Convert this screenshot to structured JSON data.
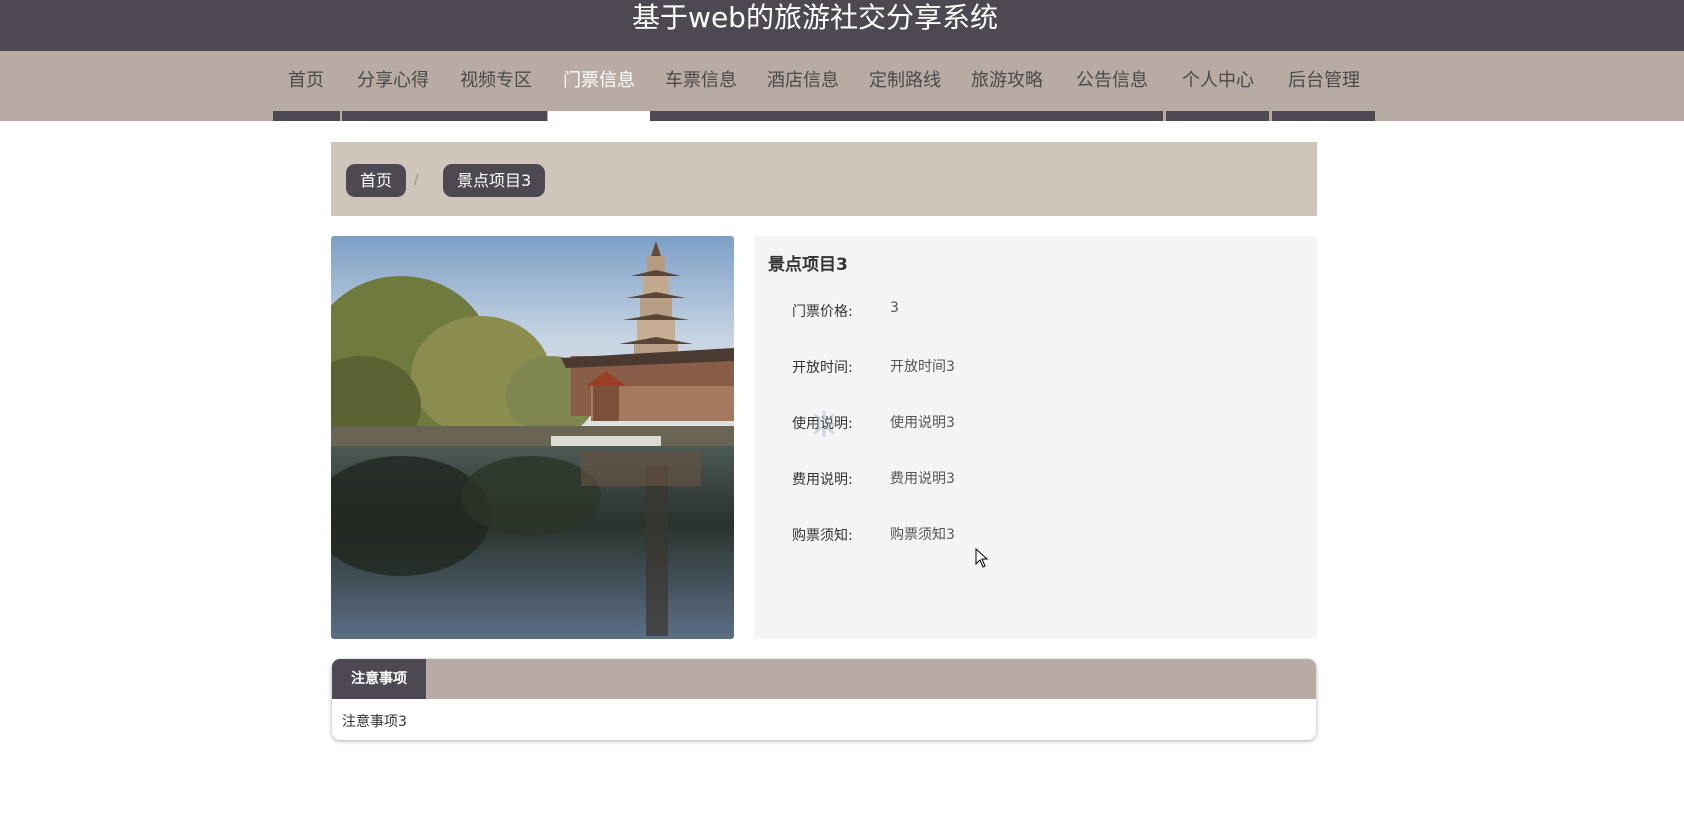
{
  "header": {
    "title": "基于web的旅游社交分享系统"
  },
  "nav": {
    "items": [
      {
        "label": "首页"
      },
      {
        "label": "分享心得"
      },
      {
        "label": "视频专区"
      },
      {
        "label": "门票信息"
      },
      {
        "label": "车票信息"
      },
      {
        "label": "酒店信息"
      },
      {
        "label": "定制路线"
      },
      {
        "label": "旅游攻略"
      },
      {
        "label": "公告信息"
      },
      {
        "label": "个人中心"
      },
      {
        "label": "后台管理"
      }
    ],
    "active": "门票信息"
  },
  "breadcrumb": {
    "home": "首页",
    "separator": "/",
    "current": "景点项目3"
  },
  "detail": {
    "title": "景点项目3",
    "fields": [
      {
        "label": "门票价格:",
        "value": "3"
      },
      {
        "label": "开放时间:",
        "value": "开放时间3"
      },
      {
        "label": "使用说明:",
        "value": "使用说明3"
      },
      {
        "label": "费用说明:",
        "value": "费用说明3"
      },
      {
        "label": "购票须知:",
        "value": "购票须知3"
      }
    ]
  },
  "tabs": {
    "active_label": "注意事项",
    "content": "注意事项3"
  },
  "colors": {
    "header_bg": "#4e4853",
    "nav_bg": "#b8aba3",
    "breadcrumb_bg": "#cfc5bb",
    "panel_bg": "#f4f4f4"
  }
}
